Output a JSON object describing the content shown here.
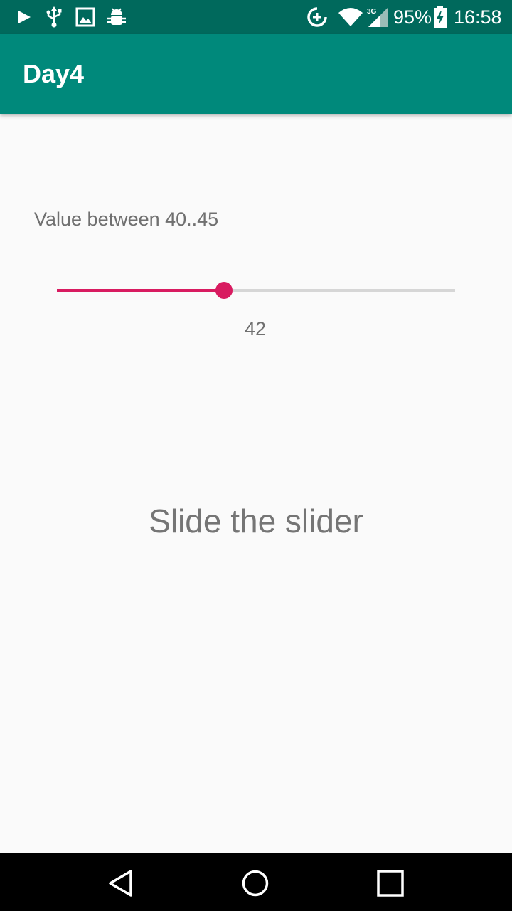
{
  "status_bar": {
    "icons_left": [
      "play-store-icon",
      "usb-icon",
      "image-icon",
      "android-debug-icon"
    ],
    "icons_right": [
      "data-saver-icon",
      "wifi-icon",
      "cellular-3g-icon",
      "battery-charging-icon"
    ],
    "network_type": "3G",
    "battery_percent": "95%",
    "time": "16:58",
    "color": "#00695c"
  },
  "app_bar": {
    "title": "Day4",
    "color": "#00897b"
  },
  "main": {
    "range_label": "Value between 40..45",
    "slider": {
      "min": 40,
      "max": 45,
      "value": 42,
      "value_label": "42",
      "fill_fraction": 0.42,
      "accent_color": "#d81b60"
    },
    "prompt": "Slide the slider"
  },
  "nav_bar": {
    "buttons": [
      "back-icon",
      "home-icon",
      "recents-icon"
    ]
  }
}
